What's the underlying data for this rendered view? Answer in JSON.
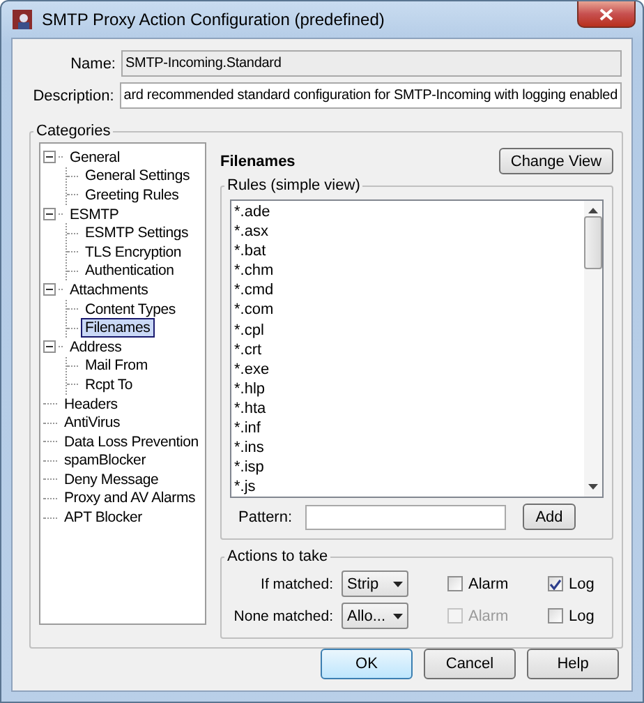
{
  "window": {
    "title": "SMTP Proxy Action Configuration (predefined)"
  },
  "name": {
    "label": "Name:",
    "value": "SMTP-Incoming.Standard"
  },
  "description": {
    "label": "Description:",
    "value": "ard recommended standard configuration for SMTP-Incoming with logging enabled"
  },
  "categories": {
    "title": "Categories",
    "items": [
      {
        "label": "General",
        "expanded": true,
        "selected": false,
        "children": [
          {
            "label": "General Settings",
            "selected": false
          },
          {
            "label": "Greeting Rules",
            "selected": false
          }
        ]
      },
      {
        "label": "ESMTP",
        "expanded": true,
        "selected": false,
        "children": [
          {
            "label": "ESMTP Settings",
            "selected": false
          },
          {
            "label": "TLS Encryption",
            "selected": false
          },
          {
            "label": "Authentication",
            "selected": false
          }
        ]
      },
      {
        "label": "Attachments",
        "expanded": true,
        "selected": false,
        "children": [
          {
            "label": "Content Types",
            "selected": false
          },
          {
            "label": "Filenames",
            "selected": true
          }
        ]
      },
      {
        "label": "Address",
        "expanded": true,
        "selected": false,
        "children": [
          {
            "label": "Mail From",
            "selected": false
          },
          {
            "label": "Rcpt To",
            "selected": false
          }
        ]
      },
      {
        "label": "Headers",
        "selected": false
      },
      {
        "label": "AntiVirus",
        "selected": false
      },
      {
        "label": "Data Loss Prevention",
        "selected": false
      },
      {
        "label": "spamBlocker",
        "selected": false
      },
      {
        "label": "Deny Message",
        "selected": false
      },
      {
        "label": "Proxy and AV Alarms",
        "selected": false
      },
      {
        "label": "APT Blocker",
        "selected": false
      }
    ]
  },
  "panel": {
    "title": "Filenames",
    "change_view": "Change View",
    "rules": {
      "title": "Rules (simple view)",
      "items": [
        "*.ade",
        "*.asx",
        "*.bat",
        "*.chm",
        "*.cmd",
        "*.com",
        "*.cpl",
        "*.crt",
        "*.exe",
        "*.hlp",
        "*.hta",
        "*.inf",
        "*.ins",
        "*.isp",
        "*.js"
      ]
    },
    "pattern": {
      "label": "Pattern:"
    },
    "add": "Add",
    "actions": {
      "title": "Actions to take",
      "rows": [
        {
          "label": "If matched:",
          "action": "Strip",
          "alarm": {
            "label": "Alarm",
            "checked": false,
            "disabled": false
          },
          "log": {
            "label": "Log",
            "checked": true,
            "disabled": false
          }
        },
        {
          "label": "None matched:",
          "action": "Allo...",
          "alarm": {
            "label": "Alarm",
            "checked": false,
            "disabled": true
          },
          "log": {
            "label": "Log",
            "checked": false,
            "disabled": false
          }
        }
      ]
    }
  },
  "buttons": [
    {
      "label": "OK",
      "default": true
    },
    {
      "label": "Cancel",
      "default": false
    },
    {
      "label": "Help",
      "default": false
    }
  ]
}
